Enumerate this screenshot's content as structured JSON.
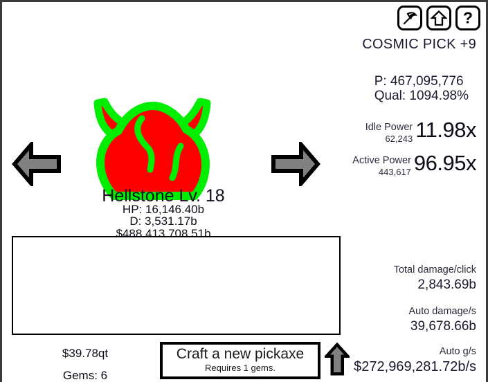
{
  "window": {
    "background_color": "#ffffff",
    "border_color": "#3a3a3a"
  },
  "toolbar": {
    "buttons": [
      {
        "name": "pickaxe-button",
        "icon": "pickaxe-icon",
        "title": "Pickaxe"
      },
      {
        "name": "upgrade-button",
        "icon": "up-arrow-icon",
        "title": "Upgrades"
      },
      {
        "name": "help-button",
        "icon": "question-mark-icon",
        "title": "Help"
      }
    ]
  },
  "pickaxe": {
    "name": "COSMIC PICK +9",
    "power_line": "P: 467,095,776",
    "quality_line": "Qual: 1094.98%"
  },
  "power": {
    "idle": {
      "label": "Idle Power",
      "value": "62,243",
      "multiplier": "11.98x"
    },
    "active": {
      "label": "Active Power",
      "value": "443,617",
      "multiplier": "96.95x"
    }
  },
  "stats": {
    "total_damage_click": {
      "label": "Total damage/click",
      "value": "2,843.69b"
    },
    "auto_damage_sec": {
      "label": "Auto damage/s",
      "value": "39,678.66b"
    },
    "auto_gold_sec": {
      "label": "Auto g/s",
      "value": "$272,969,281.72b/s"
    }
  },
  "monster": {
    "name": "Hellstone Lv. 18",
    "hp": "HP: 16,146.40b",
    "damage": "D: 3,531.17b",
    "gold": "$488,413,708.51b",
    "sprite_fill": "#FF0000",
    "sprite_outline": "#00EE00",
    "prev_arrow": "left-arrow-icon",
    "next_arrow": "right-arrow-icon",
    "arrow_fill": "#808080",
    "arrow_outline": "#000000"
  },
  "log": {
    "lines": []
  },
  "currency": {
    "money": "$39.78qt",
    "gems": "Gems: 6"
  },
  "craft": {
    "label": "Craft a new pickaxe",
    "requirement": "Requires 1 gems."
  },
  "upgrade_arrow": {
    "icon": "up-arrow-icon",
    "fill": "#808080",
    "outline": "#000000"
  }
}
